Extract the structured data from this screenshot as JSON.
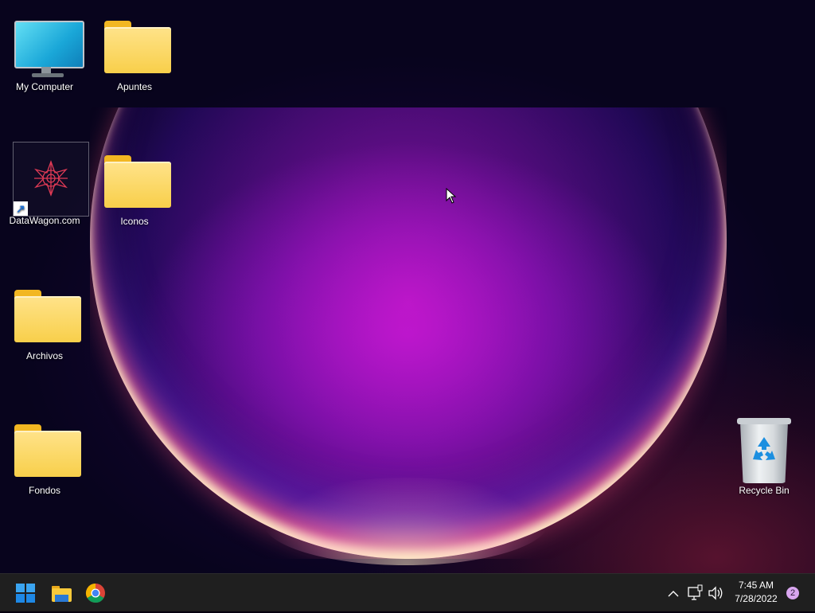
{
  "desktop": {
    "icons": [
      {
        "label": "My Computer"
      },
      {
        "label": "Apuntes"
      },
      {
        "label": "DataWagon.com"
      },
      {
        "label": "Iconos"
      },
      {
        "label": "Archivos"
      },
      {
        "label": "Fondos"
      },
      {
        "label": "Recycle Bin"
      }
    ]
  },
  "taskbar": {
    "time": "7:45 AM",
    "date": "7/28/2022",
    "notification_count": "2"
  }
}
